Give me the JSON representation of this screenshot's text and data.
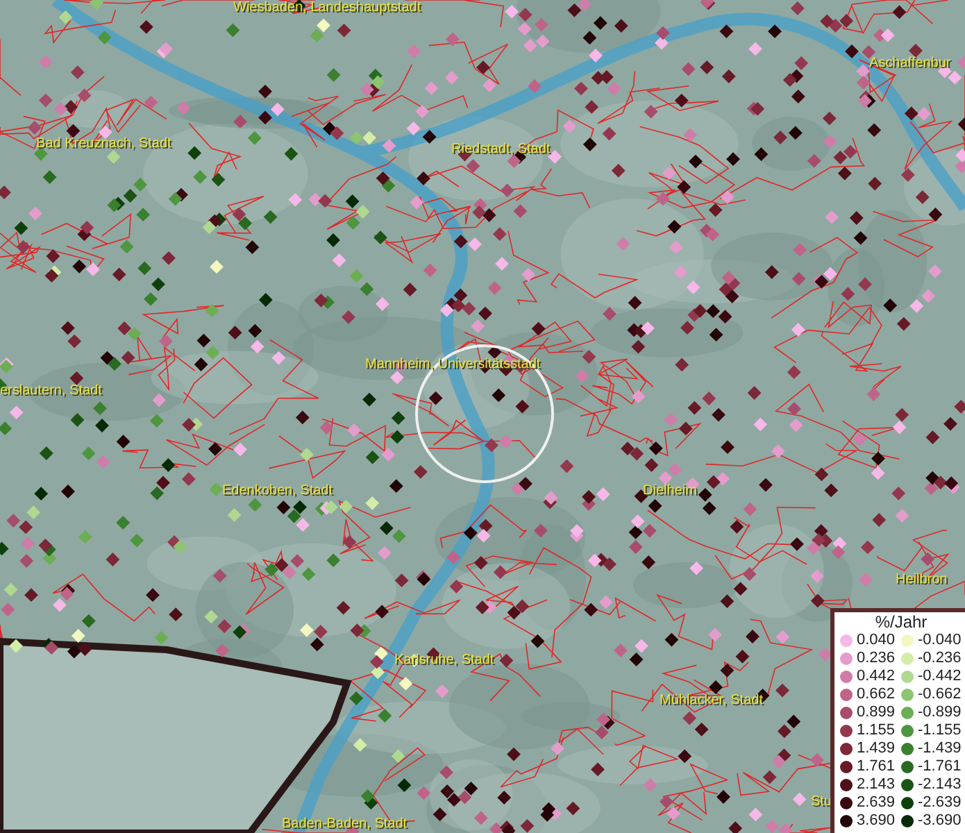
{
  "map": {
    "labels": [
      {
        "text": "Wiesbaden, Landeshauptstadt"
      },
      {
        "text": "Aschaffenbur"
      },
      {
        "text": "Bad Kreuznach, Stadt"
      },
      {
        "text": "Riedstadt, Stadt"
      },
      {
        "text": "Mannheim, Universitätsstadt"
      },
      {
        "text": "erslautern, Stadt"
      },
      {
        "text": "Edenkoben, Stadt"
      },
      {
        "text": "Dielheim"
      },
      {
        "text": "Heilbron"
      },
      {
        "text": "Karlsruhe, Stadt"
      },
      {
        "text": "Mühlacker, Stadt"
      },
      {
        "text": "Baden-Baden, Stadt"
      },
      {
        "text": "Stu"
      }
    ]
  },
  "legend": {
    "title": "%/Jahr",
    "positive": [
      {
        "value": "0.040",
        "color": "#f6b8e8"
      },
      {
        "value": "0.236",
        "color": "#e49ccc"
      },
      {
        "value": "0.442",
        "color": "#d07ca8"
      },
      {
        "value": "0.662",
        "color": "#bf6488"
      },
      {
        "value": "0.899",
        "color": "#a84c6c"
      },
      {
        "value": "1.155",
        "color": "#94384f"
      },
      {
        "value": "1.439",
        "color": "#7c2838"
      },
      {
        "value": "1.761",
        "color": "#661a26"
      },
      {
        "value": "2.143",
        "color": "#4e0f18"
      },
      {
        "value": "2.639",
        "color": "#3a0810"
      },
      {
        "value": "3.690",
        "color": "#220406"
      }
    ],
    "negative": [
      {
        "value": "-0.040",
        "color": "#f4f8c0"
      },
      {
        "value": "-0.236",
        "color": "#d4eca8"
      },
      {
        "value": "-0.442",
        "color": "#b0d890"
      },
      {
        "value": "-0.662",
        "color": "#8cc470"
      },
      {
        "value": "-0.899",
        "color": "#6cae54"
      },
      {
        "value": "-1.155",
        "color": "#4e9640"
      },
      {
        "value": "-1.439",
        "color": "#3a802e"
      },
      {
        "value": "-1.761",
        "color": "#286a20"
      },
      {
        "value": "-2.143",
        "color": "#1a5414"
      },
      {
        "value": "-2.639",
        "color": "#0e400c"
      },
      {
        "value": "-3.690",
        "color": "#062a06"
      }
    ]
  }
}
